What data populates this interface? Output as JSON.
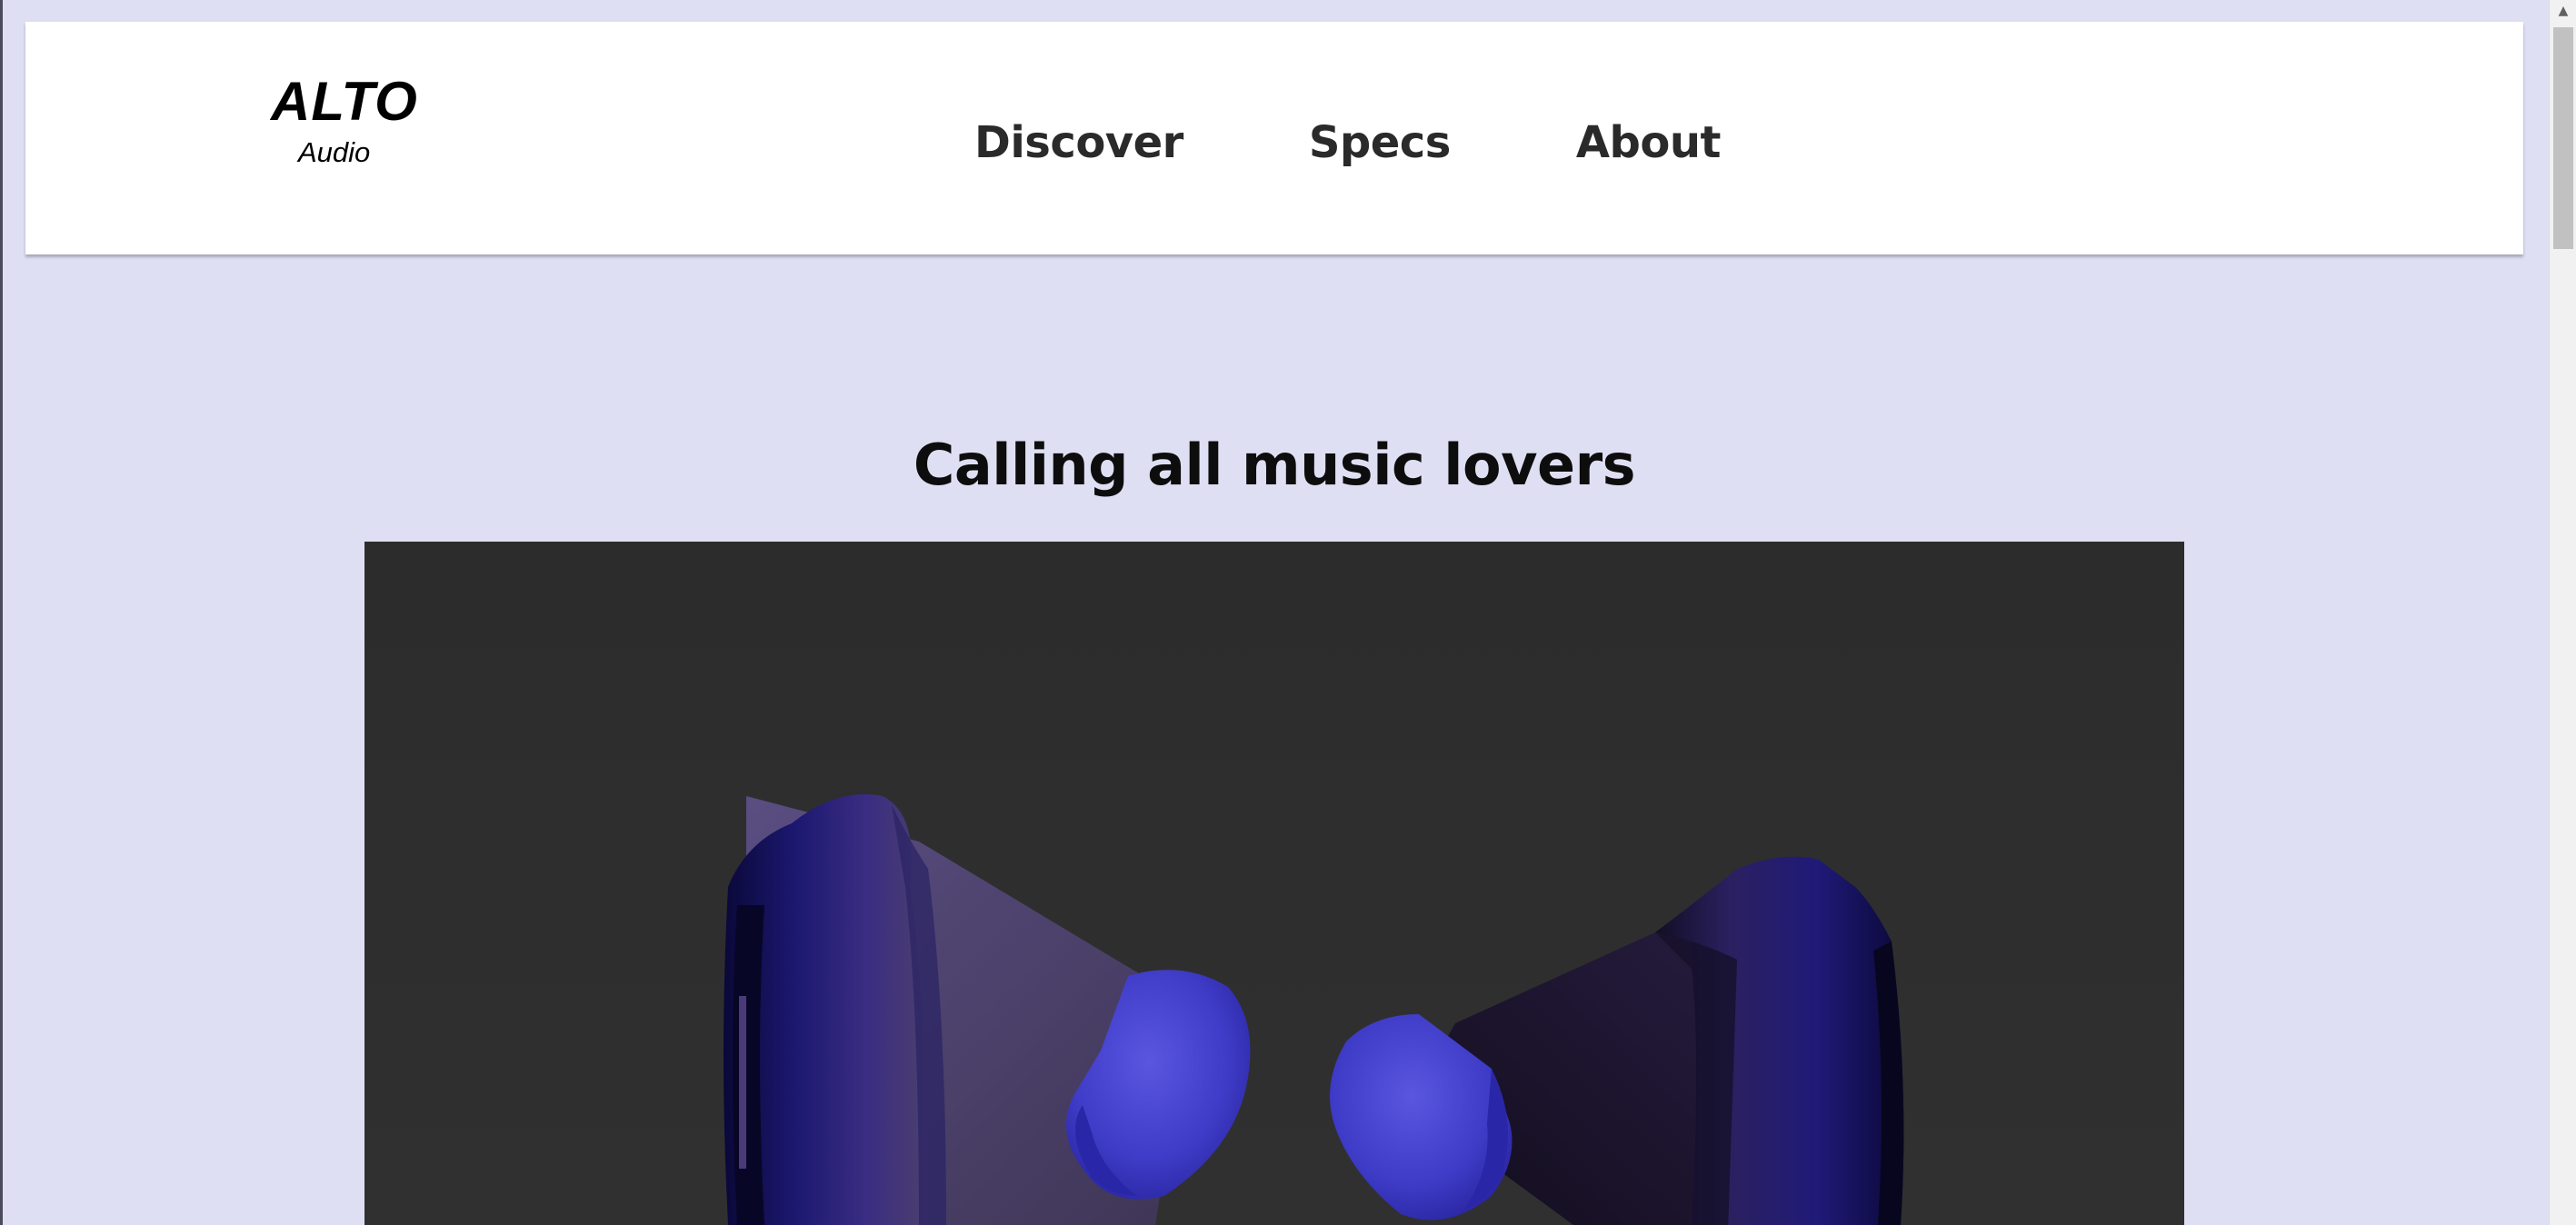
{
  "brand": {
    "name": "ALTO",
    "subtitle": "Audio"
  },
  "nav": {
    "items": [
      {
        "label": "Discover"
      },
      {
        "label": "Specs"
      },
      {
        "label": "About"
      }
    ]
  },
  "hero": {
    "title": "Calling all music lovers"
  },
  "product_view": {
    "icon": "earbuds-3d-render",
    "colors": {
      "background": "#2e2e2e",
      "earbud_shell": "#1c1870",
      "ear_tip": "#4a46d0"
    }
  },
  "scrollbar": {
    "up_icon": "triangle-up-icon"
  },
  "colors": {
    "page_background": "#dfdff4",
    "header_background": "#ffffff",
    "text": "#2a2a2a"
  }
}
